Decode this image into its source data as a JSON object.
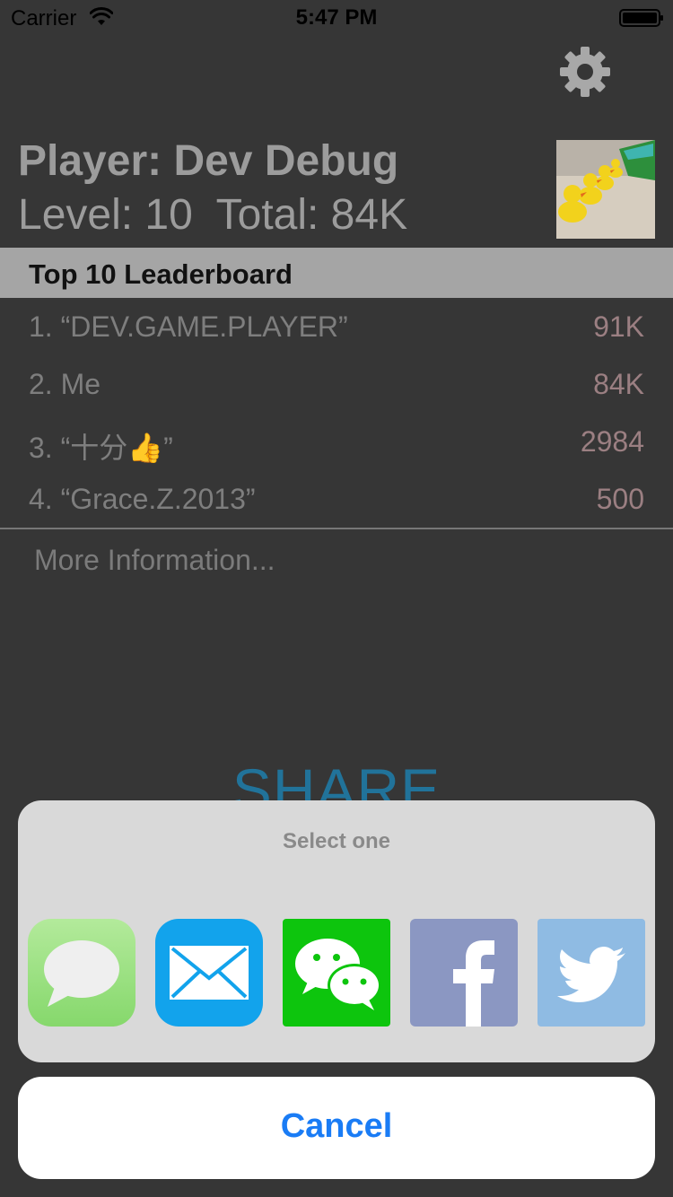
{
  "status_bar": {
    "carrier": "Carrier",
    "time": "5:47 PM"
  },
  "player": {
    "name": "Player: Dev Debug",
    "stats": "Level: 10  Total: 84K"
  },
  "leaderboard": {
    "title": "Top 10 Leaderboard",
    "rows": [
      {
        "name": "1. “DEV.GAME.PLAYER”",
        "score": "91K"
      },
      {
        "name": "2. Me",
        "score": "84K"
      },
      {
        "name": "3. “十分👍”",
        "score": "2984"
      },
      {
        "name": "4. “Grace.Z.2013”",
        "score": "500"
      }
    ],
    "more": "More Information..."
  },
  "share_label": "SHARE",
  "share_sheet": {
    "title": "Select one",
    "apps": [
      "messages-icon",
      "mail-icon",
      "wechat-icon",
      "facebook-icon",
      "twitter-icon"
    ],
    "cancel": "Cancel"
  },
  "colors": {
    "accent": "#1a7cf5",
    "share": "#21739a",
    "background": "#363636"
  }
}
